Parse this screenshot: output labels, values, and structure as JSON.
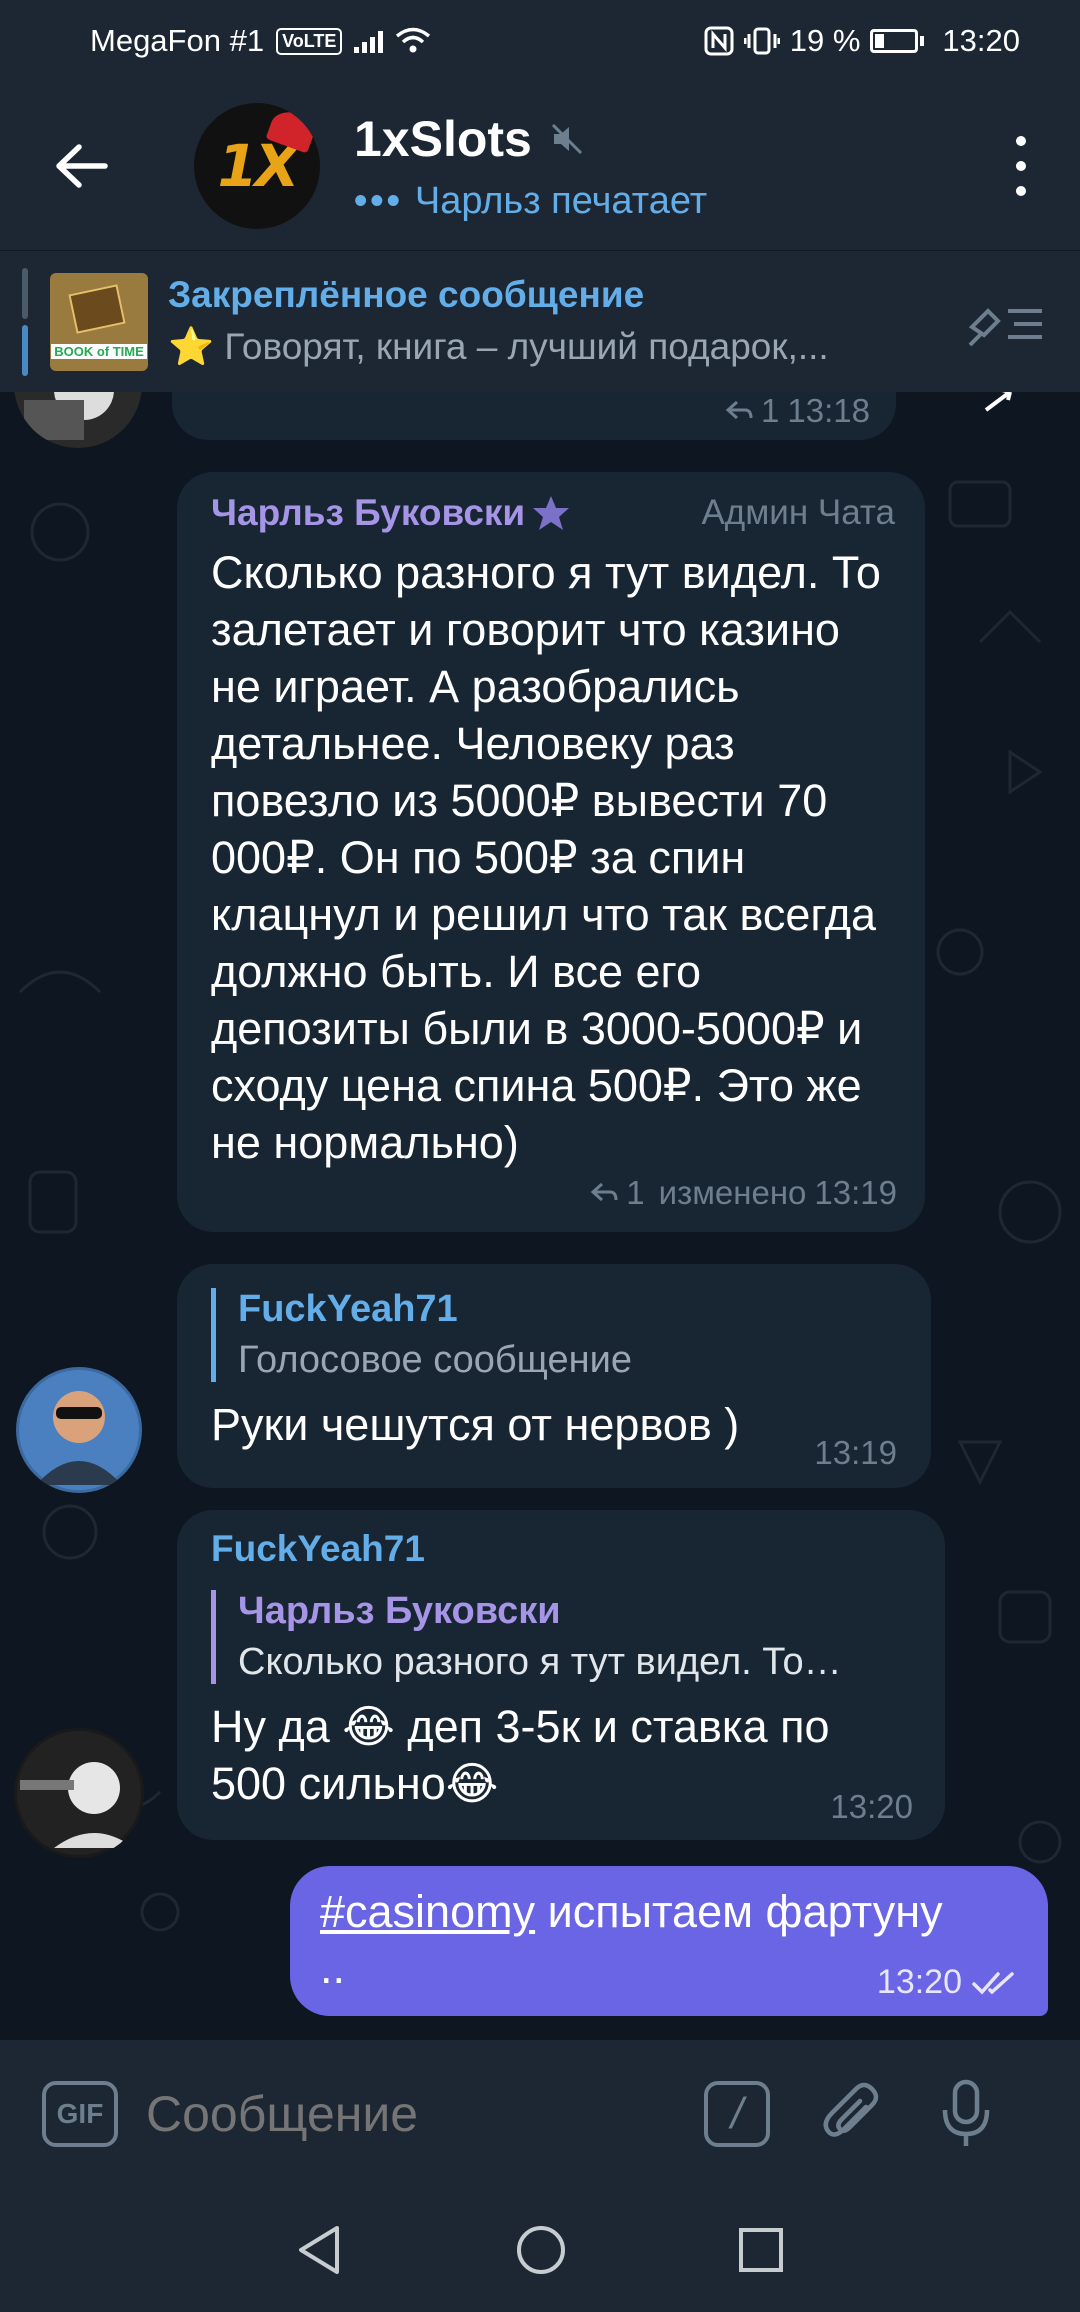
{
  "status_bar": {
    "carrier": "MegaFon #1",
    "volte": "VoLTE",
    "battery": "19 %",
    "time": "13:20"
  },
  "header": {
    "title": "1xSlots",
    "typing": "Чарльз печатает",
    "avatar_text": "1X"
  },
  "pinned": {
    "title": "Закреплённое сообщение",
    "text": "⭐ Говорят, книга – лучший подарок,...",
    "thumb_label": "BOOK of TIME"
  },
  "messages": [
    {
      "id": "top-partial",
      "replies": "1",
      "time": "13:18"
    },
    {
      "id": "charles",
      "sender": "Чарльз Буковски",
      "role": "Админ Чата",
      "text": "Сколько разного я тут видел. То залетает и говорит что казино не играет. А разобрались детальнее. Человеку раз повезло из 5000₽ вывести 70 000₽. Он по 500₽ за спин клацнул и решил что так всегда должно быть. И все его депозиты были в 3000-5000₽ и сходу цена спина 500₽. Это же не нормально)",
      "replies": "1",
      "edited": "изменено",
      "time": "13:19"
    },
    {
      "id": "fuckyeah-voice-reply",
      "reply_name": "FuckYeah71",
      "reply_text": "Голосовое сообщение",
      "text": "Руки чешутся от нервов )",
      "time": "13:19"
    },
    {
      "id": "fuckyeah-reply",
      "sender": "FuckYeah71",
      "reply_name": "Чарльз Буковски",
      "reply_text": "Сколько разного я тут видел. То…",
      "text": "Ну да 😂 деп 3-5к и ставка по 500 сильно😂",
      "time": "13:20"
    }
  ],
  "own_message": {
    "hashtag": "#casinomy",
    "text": " испытаем фартуну ..",
    "time": "13:20"
  },
  "input": {
    "placeholder": "Сообщение",
    "gif_label": "GIF",
    "command_label": "/"
  },
  "colors": {
    "background": "#0e1621",
    "panel": "#1c2733",
    "bubble": "#182533",
    "own_bubble": "#6a65e4",
    "link": "#63aee9",
    "admin_name": "#a695e7"
  }
}
